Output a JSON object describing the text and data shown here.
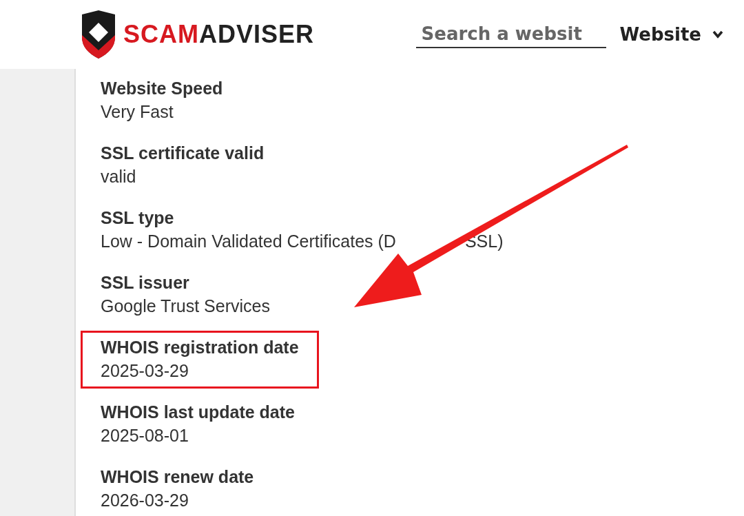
{
  "header": {
    "logo": {
      "part_1": "SCAM",
      "part_2": "ADVISER"
    },
    "search": {
      "placeholder": "Search a websit"
    },
    "dropdown": {
      "label": "Website"
    }
  },
  "details": [
    {
      "label": "Website Speed",
      "value": "Very Fast",
      "highlighted": false
    },
    {
      "label": "SSL certificate valid",
      "value": "valid",
      "highlighted": false
    },
    {
      "label": "SSL type",
      "value": "Low - Domain Validated Certificates (D",
      "value_after_arrow": "SSL)",
      "highlighted": false
    },
    {
      "label": "SSL issuer",
      "value": "Google Trust Services",
      "highlighted": false
    },
    {
      "label": "WHOIS registration date",
      "value": "2025-03-29",
      "highlighted": true
    },
    {
      "label": "WHOIS last update date",
      "value": "2025-08-01",
      "highlighted": false
    },
    {
      "label": "WHOIS renew date",
      "value": "2026-03-29",
      "highlighted": false
    }
  ]
}
